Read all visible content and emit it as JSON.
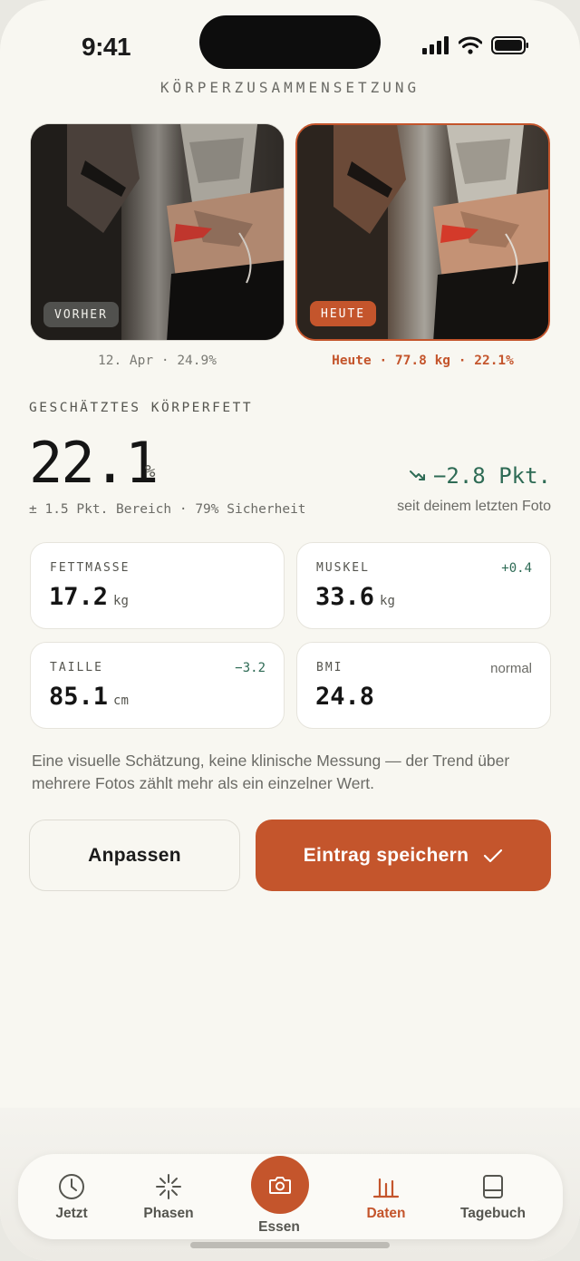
{
  "status": {
    "time": "9:41"
  },
  "screen": {
    "title": "KÖRPERZUSAMMENSETZUNG"
  },
  "photos": {
    "before": {
      "tag": "VORHER",
      "caption": "12. Apr · 24.9%"
    },
    "after": {
      "tag": "HEUTE",
      "caption": "Heute · 77.8 kg · 22.1%"
    }
  },
  "estimate": {
    "label": "GESCHÄTZTES KÖRPERFETT",
    "value": "22.1",
    "unit": "%",
    "delta": "−2.8 Pkt.",
    "delta_caption": "seit deinem letzten Foto",
    "range": "± 1.5 Pkt. Bereich · 79% Sicherheit"
  },
  "metrics": [
    {
      "label": "FETTMASSE",
      "value": "17.2",
      "unit": "kg",
      "badge": ""
    },
    {
      "label": "MUSKEL",
      "value": "33.6",
      "unit": "kg",
      "badge": "+0.4"
    },
    {
      "label": "TAILLE",
      "value": "85.1",
      "unit": "cm",
      "badge": "−3.2"
    },
    {
      "label": "BMI",
      "value": "24.8",
      "unit": "",
      "badge": "normal"
    }
  ],
  "disclaimer": "Eine visuelle Schätzung, keine klinische Messung — der Trend über mehrere Fotos zählt mehr als ein einzelner Wert.",
  "actions": {
    "adjust": "Anpassen",
    "save": "Eintrag speichern"
  },
  "tabs": {
    "now": "Jetzt",
    "phases": "Phasen",
    "food": "Essen",
    "data": "Daten",
    "journal": "Tagebuch",
    "active": "Daten"
  },
  "colors": {
    "accent": "#c4552c",
    "positive": "#2e6b55",
    "background": "#f8f7f1"
  }
}
